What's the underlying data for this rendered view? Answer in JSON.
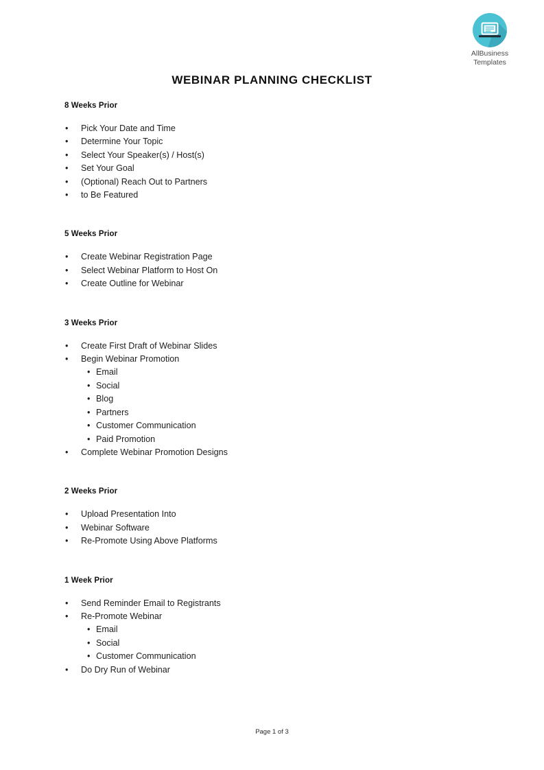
{
  "brand": {
    "logo_icon": "laptop-icon",
    "circle_color": "#4BC2D3",
    "shadow_color": "#38A3B4",
    "line1": "AllBusiness",
    "line2": "Templates"
  },
  "document": {
    "title": "WEBINAR PLANNING CHECKLIST",
    "footer": "Page 1 of 3"
  },
  "sections": [
    {
      "heading": "8 Weeks Prior",
      "items": [
        {
          "text": "Pick Your Date and Time"
        },
        {
          "text": "Determine Your Topic"
        },
        {
          "text": "Select Your Speaker(s) / Host(s)"
        },
        {
          "text": "Set Your Goal"
        },
        {
          "text": "(Optional) Reach Out to Partners"
        },
        {
          "text": "to Be Featured"
        }
      ]
    },
    {
      "heading": "5 Weeks Prior",
      "items": [
        {
          "text": "Create Webinar Registration Page"
        },
        {
          "text": "Select Webinar Platform to Host On"
        },
        {
          "text": "Create Outline for Webinar"
        }
      ]
    },
    {
      "heading": "3 Weeks Prior",
      "items": [
        {
          "text": "Create First Draft of Webinar Slides"
        },
        {
          "text": "Begin Webinar Promotion"
        },
        {
          "text": "Email",
          "level": 2
        },
        {
          "text": "Social",
          "level": 2
        },
        {
          "text": "Blog",
          "level": 2
        },
        {
          "text": "Partners",
          "level": 2
        },
        {
          "text": "Customer Communication",
          "level": 2
        },
        {
          "text": "Paid Promotion",
          "level": 2
        },
        {
          "text": "Complete Webinar Promotion Designs"
        }
      ]
    },
    {
      "heading": "2 Weeks Prior",
      "items": [
        {
          "text": "Upload Presentation Into"
        },
        {
          "text": "Webinar Software"
        },
        {
          "text": "Re-Promote Using Above Platforms"
        }
      ]
    },
    {
      "heading": "1 Week Prior",
      "items": [
        {
          "text": "Send Reminder Email to Registrants"
        },
        {
          "text": "Re-Promote Webinar"
        },
        {
          "text": "Email",
          "level": 2
        },
        {
          "text": "Social",
          "level": 2
        },
        {
          "text": "Customer Communication",
          "level": 2
        },
        {
          "text": "Do Dry Run of Webinar"
        }
      ]
    }
  ],
  "glyphs": {
    "bullet": "•"
  }
}
